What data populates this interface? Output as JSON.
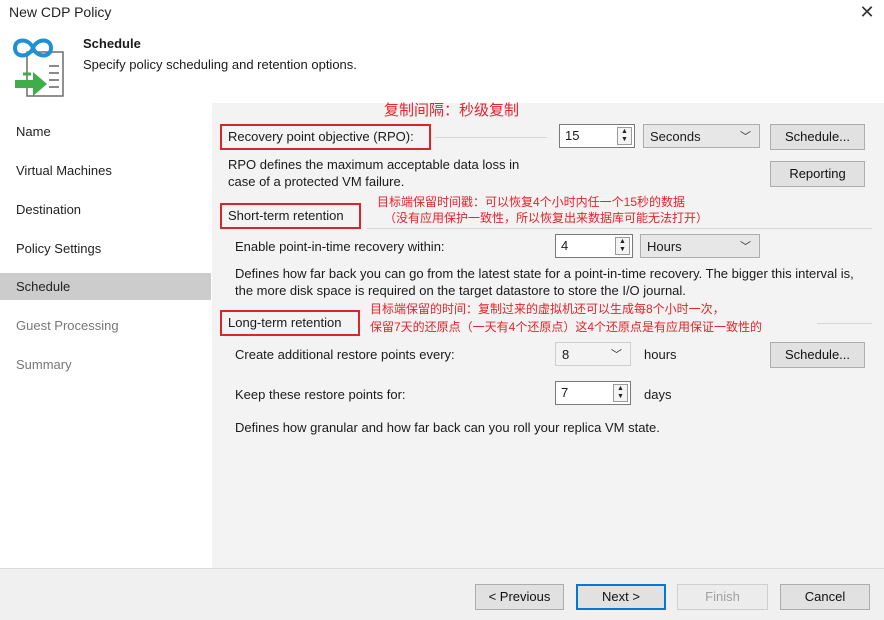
{
  "window": {
    "title": "New CDP Policy",
    "close_glyph": "✕"
  },
  "header": {
    "title": "Schedule",
    "subtitle": "Specify policy scheduling and retention options.",
    "icon": "cdp-policy-icon"
  },
  "sidebar": {
    "items": [
      {
        "label": "Name",
        "state": "normal"
      },
      {
        "label": "Virtual Machines",
        "state": "normal"
      },
      {
        "label": "Destination",
        "state": "normal"
      },
      {
        "label": "Policy Settings",
        "state": "normal"
      },
      {
        "label": "Schedule",
        "state": "selected"
      },
      {
        "label": "Guest Processing",
        "state": "disabled"
      },
      {
        "label": "Summary",
        "state": "disabled"
      }
    ]
  },
  "rpo": {
    "label": "Recovery point objective (RPO):",
    "value": "15",
    "unit": "Seconds",
    "schedule_button": "Schedule...",
    "reporting_button": "Reporting",
    "description": "RPO defines the maximum acceptable data loss in case of a protected VM failure."
  },
  "short_term": {
    "heading": "Short-term retention",
    "enable_label": "Enable point-in-time recovery within:",
    "value": "4",
    "unit": "Hours",
    "description": "Defines how far back you can go from the latest state for a point-in-time recovery. The bigger this interval is, the more disk space is required on the target datastore to store the I/O journal."
  },
  "long_term": {
    "heading": "Long-term retention",
    "create_label": "Create additional restore points every:",
    "create_value": "8",
    "create_unit": "hours",
    "schedule_button": "Schedule...",
    "keep_label": "Keep these restore points for:",
    "keep_value": "7",
    "keep_unit": "days",
    "description": "Defines how granular and how far back can you roll your replica VM state."
  },
  "annotations": {
    "rpo_note": "复制间隔：秒级复制",
    "short_note_1": "目标端保留时间戳：可以恢复4个小时内任一个15秒的数据",
    "short_note_2": "（没有应用保护一致性，所以恢复出来数据库可能无法打开）",
    "long_note_1": "目标端保留的时间：复制过来的虚拟机还可以生成每8个小时一次，",
    "long_note_2": "保留7天的还原点（一天有4个还原点）这4个还原点是有应用保证一致性的",
    "color": "#e5232a"
  },
  "footer": {
    "previous": "< Previous",
    "next": "Next >",
    "finish": "Finish",
    "cancel": "Cancel"
  }
}
